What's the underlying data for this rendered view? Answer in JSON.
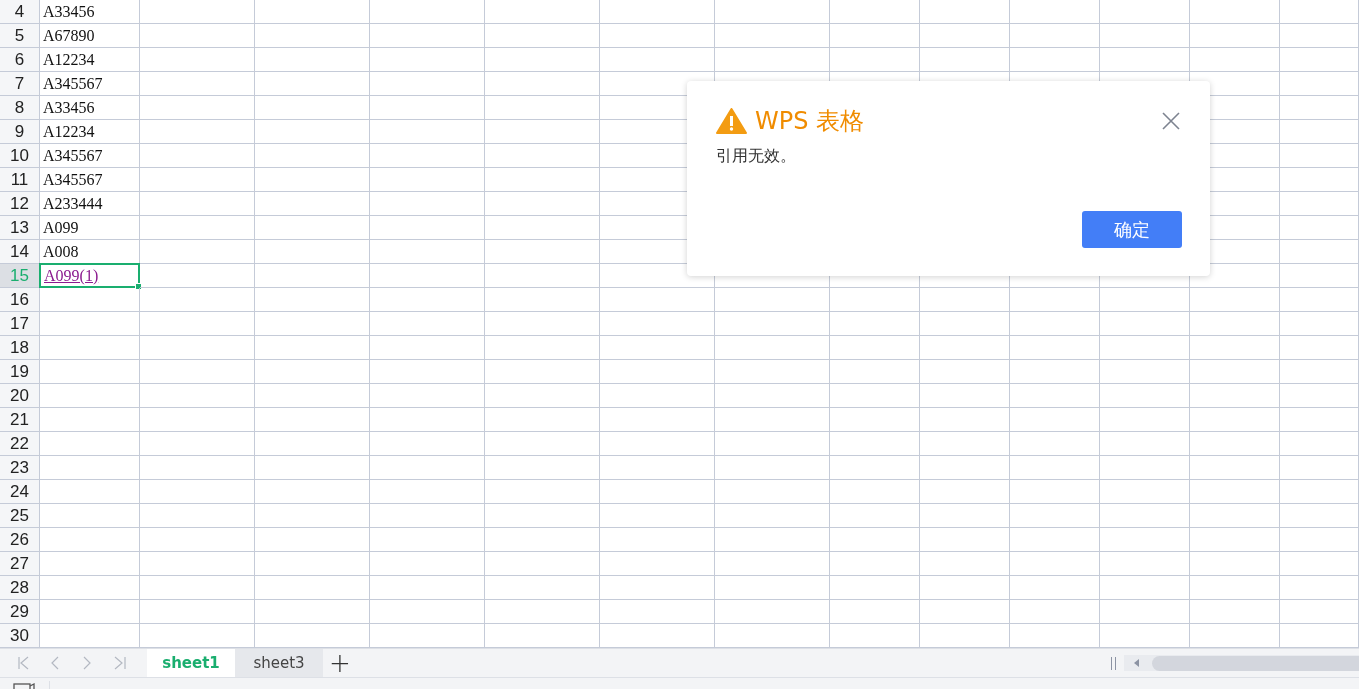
{
  "rows": [
    {
      "number": "4",
      "value": "A33456",
      "kind": "text",
      "selected": false
    },
    {
      "number": "5",
      "value": "A67890",
      "kind": "text",
      "selected": false
    },
    {
      "number": "6",
      "value": "A12234",
      "kind": "text",
      "selected": false
    },
    {
      "number": "7",
      "value": "A345567",
      "kind": "text",
      "selected": false
    },
    {
      "number": "8",
      "value": "A33456",
      "kind": "text",
      "selected": false
    },
    {
      "number": "9",
      "value": "A12234",
      "kind": "text",
      "selected": false
    },
    {
      "number": "10",
      "value": "A345567",
      "kind": "text",
      "selected": false
    },
    {
      "number": "11",
      "value": "A345567",
      "kind": "text",
      "selected": false
    },
    {
      "number": "12",
      "value": "A233444",
      "kind": "text",
      "selected": false
    },
    {
      "number": "13",
      "value": "A099",
      "kind": "text",
      "selected": false
    },
    {
      "number": "14",
      "value": "A008",
      "kind": "text",
      "selected": false
    },
    {
      "number": "15",
      "value": "A099(1)",
      "kind": "link",
      "selected": true
    },
    {
      "number": "16",
      "selected": false
    },
    {
      "number": "17",
      "selected": false
    },
    {
      "number": "18",
      "selected": false
    },
    {
      "number": "19",
      "selected": false
    },
    {
      "number": "20",
      "selected": false
    },
    {
      "number": "21",
      "selected": false
    },
    {
      "number": "22",
      "selected": false
    },
    {
      "number": "23",
      "selected": false
    },
    {
      "number": "24",
      "selected": false
    },
    {
      "number": "25",
      "selected": false
    },
    {
      "number": "26",
      "selected": false
    },
    {
      "number": "27",
      "selected": false
    },
    {
      "number": "28",
      "selected": false
    },
    {
      "number": "29",
      "selected": false
    },
    {
      "number": "30",
      "selected": false
    }
  ],
  "sheet_tabs": [
    {
      "label": "sheet1",
      "selected": true
    },
    {
      "label": "sheet3",
      "selected": false
    }
  ],
  "add_sheet": "+",
  "dialog": {
    "title": "WPS 表格",
    "message": "引用无效。",
    "button": "确定"
  }
}
